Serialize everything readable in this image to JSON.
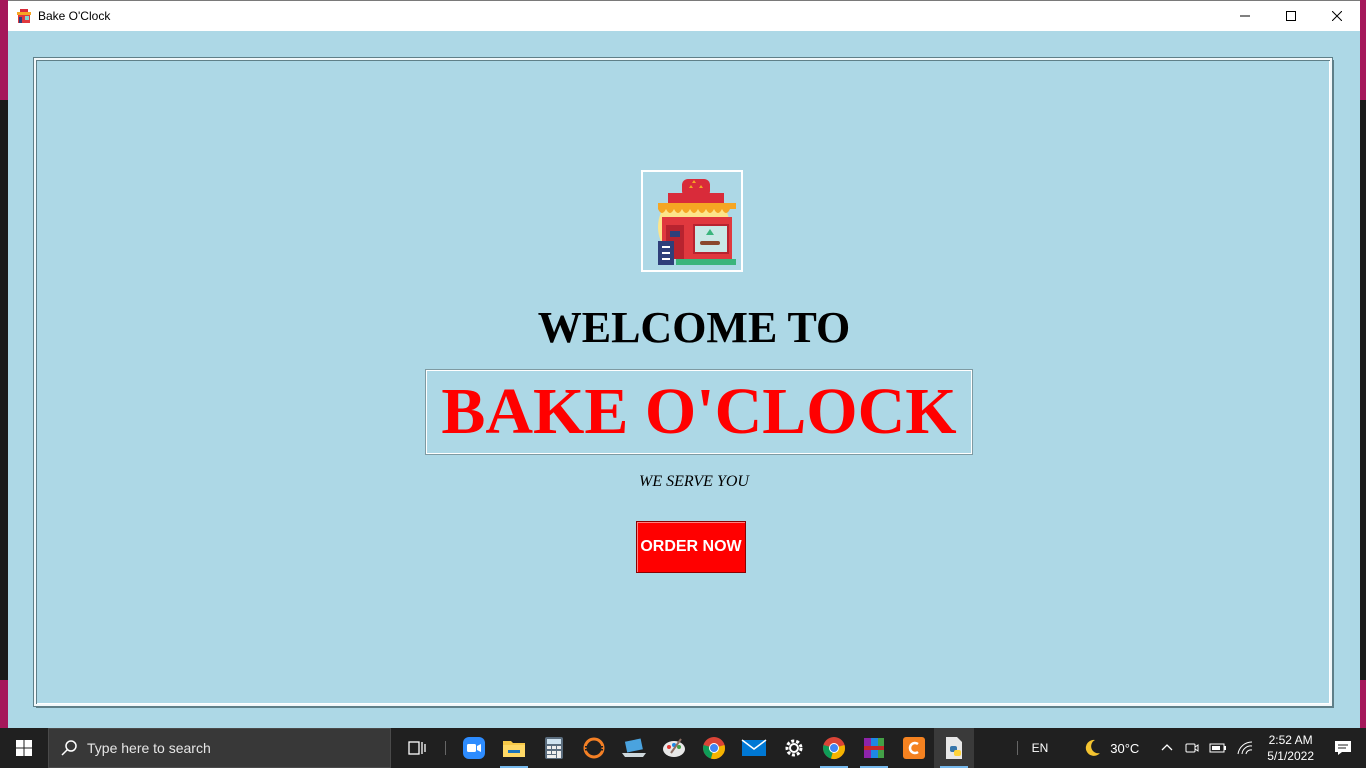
{
  "window": {
    "title": "Bake O'Clock",
    "controls": {
      "minimize": "—",
      "maximize": "☐",
      "close": "✕"
    }
  },
  "main": {
    "logo_icon": "bakery-shop-icon",
    "welcome": "WELCOME TO",
    "brand": "BAKE O'CLOCK",
    "tagline": "WE SERVE YOU",
    "order_button": "ORDER NOW"
  },
  "colors": {
    "background": "#add8e6",
    "brand": "#ff0000",
    "button": "#ff0000"
  },
  "taskbar": {
    "search_placeholder": "Type here to search",
    "apps": [
      "task-view-icon",
      "zoom-icon",
      "file-explorer-icon",
      "calculator-icon",
      "eclipse-icon",
      "laptop-icon",
      "paint-icon",
      "chrome-icon",
      "mail-icon",
      "settings-icon",
      "chrome-icon",
      "winrar-icon",
      "ms-editor-icon",
      "python-file-icon"
    ],
    "language": "EN",
    "weather": "30°C",
    "time": "2:52 AM",
    "date": "5/1/2022"
  }
}
